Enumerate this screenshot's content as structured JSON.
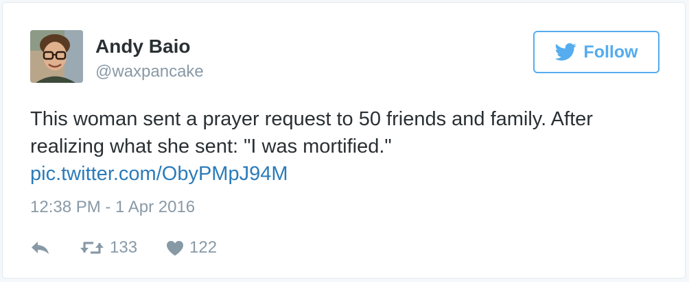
{
  "tweet": {
    "author": {
      "name": "Andy Baio",
      "handle": "@waxpancake",
      "avatar_icon": "avatar-photo"
    },
    "follow_button": {
      "label": "Follow",
      "icon": "twitter-bird-icon"
    },
    "text_lines": [
      "This woman sent a prayer request to 50 friends and family. After",
      "realizing what she sent: \"I was mortified.\""
    ],
    "link": "pic.twitter.com/ObyPMpJ94M",
    "timestamp": "12:38 PM - 1 Apr 2016",
    "actions": {
      "reply_icon": "reply-icon",
      "retweet_icon": "retweet-icon",
      "retweet_count": "133",
      "like_icon": "heart-icon",
      "like_count": "122"
    }
  },
  "colors": {
    "accent": "#55acee",
    "link": "#2b7bb9",
    "text": "#292f33",
    "muted": "#8899a6"
  }
}
